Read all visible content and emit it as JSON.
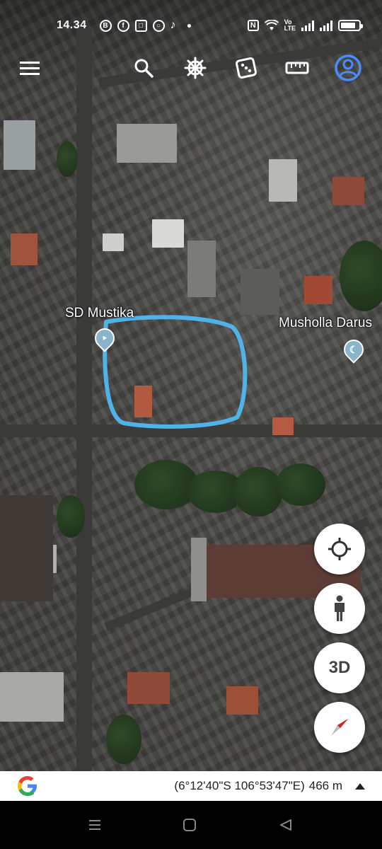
{
  "status_bar": {
    "time": "14.34",
    "notification_icons": [
      "B",
      "f",
      "bag",
      "circle",
      "tiktok"
    ],
    "right_icons": [
      "nfc-icon",
      "wifi-icon",
      "volte-icon",
      "signal-icon",
      "signal-icon",
      "battery-icon"
    ],
    "volte_label": "Vo\nLTE"
  },
  "toolbar": {
    "icons": [
      "menu-icon",
      "search-icon",
      "voyager-icon",
      "dice-icon",
      "ruler-icon",
      "account-icon"
    ]
  },
  "map": {
    "labels": [
      {
        "text": "SD Mustika",
        "icon": "school-pin-icon"
      },
      {
        "text": "Musholla Darus",
        "icon": "mosque-pin-icon"
      }
    ],
    "annotation_color": "#4fb3e8"
  },
  "fabs": {
    "location": "crosshair-icon",
    "pegman": "pegman-icon",
    "three_d_label": "3D",
    "compass": "compass-icon"
  },
  "info_bar": {
    "logo": "G",
    "coordinates": "(6°12'40\"S 106°53'47\"E)",
    "scale": "466 m"
  },
  "nav_bar": [
    "recents-icon",
    "home-icon",
    "back-icon"
  ]
}
